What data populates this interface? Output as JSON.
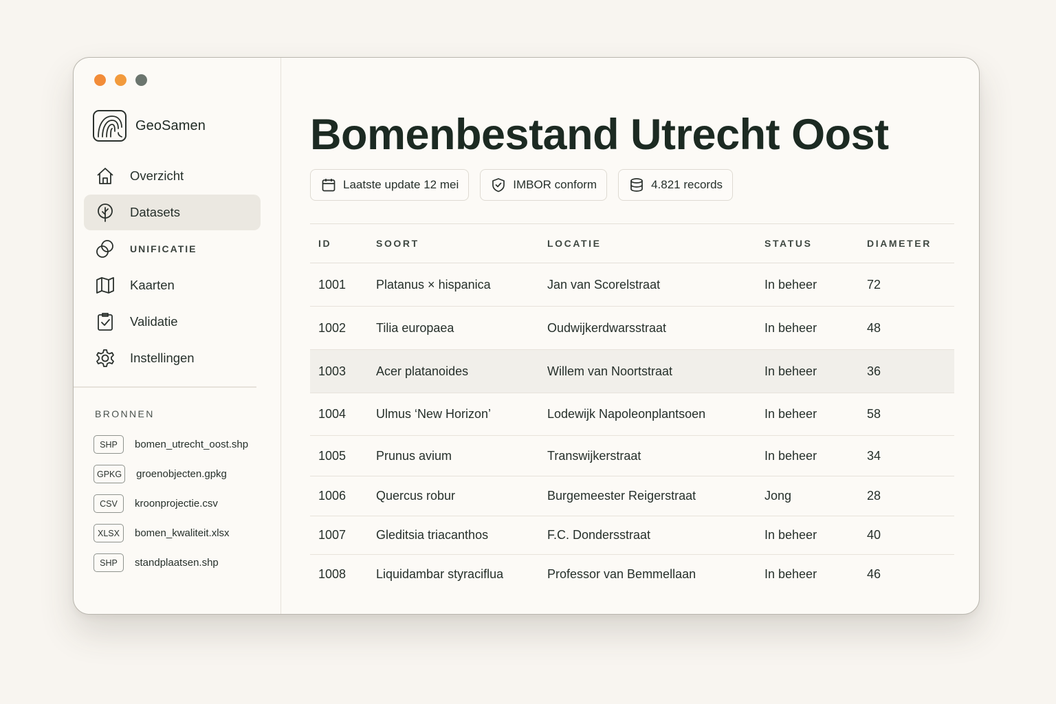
{
  "window": {
    "traffic_lights": [
      {
        "name": "close",
        "color": "#f28c38"
      },
      {
        "name": "minimize",
        "color": "#f29a3c"
      },
      {
        "name": "zoom",
        "color": "#6b756e"
      }
    ]
  },
  "sidebar": {
    "brand": "GeoSamen",
    "nav": [
      {
        "label": "Overzicht",
        "icon": "home-icon",
        "active": false
      },
      {
        "label": "Datasets",
        "icon": "tree-icon",
        "active": true
      },
      {
        "label": "UNIFICATIE",
        "icon": "overlap-circles-icon",
        "active": false
      },
      {
        "label": "Kaarten",
        "icon": "map-icon",
        "active": false
      },
      {
        "label": "Validatie",
        "icon": "clipboard-check-icon",
        "active": false
      },
      {
        "label": "Instellingen",
        "icon": "gear-icon",
        "active": false
      }
    ],
    "sources_title": "BRONNEN",
    "sources": [
      {
        "type": "SHP",
        "name": "bomen_utrecht_oost.shp"
      },
      {
        "type": "GPKG",
        "name": "groenobjecten.gpkg"
      },
      {
        "type": "CSV",
        "name": "kroonprojectie.csv"
      },
      {
        "type": "XLSX",
        "name": "bomen_kwaliteit.xlsx"
      },
      {
        "type": "SHP",
        "name": "standplaatsen.shp"
      }
    ]
  },
  "main": {
    "title": "Bomenbestand Utrecht Oost",
    "pills": [
      {
        "icon": "calendar-icon",
        "text": "Laatste update 12 mei"
      },
      {
        "icon": "shield-check-icon",
        "text": "IMBOR conform"
      },
      {
        "icon": "database-icon",
        "text": "4.821 records"
      }
    ],
    "table": {
      "headers": [
        "ID",
        "SOORT",
        "LOCATIE",
        "STATUS",
        "DIAMETER"
      ],
      "rows": [
        [
          "1001",
          "Platanus × hispanica",
          "Jan van Scorelstraat",
          "In beheer",
          "72"
        ],
        [
          "1002",
          "Tilia europaea",
          "Oudwijkerdwarsstraat",
          "In beheer",
          "48"
        ],
        [
          "1003",
          "Acer platanoides",
          "Willem van Noortstraat",
          "In beheer",
          "36"
        ],
        [
          "1004",
          "Ulmus ‘New Horizon’",
          "Lodewijk Napoleonplantsoen",
          "In beheer",
          "58"
        ],
        [
          "1005",
          "Prunus avium",
          "Transwijkerstraat",
          "In beheer",
          "34"
        ],
        [
          "1006",
          "Quercus robur",
          "Burgemeester Reigerstraat",
          "Jong",
          "28"
        ],
        [
          "1007",
          "Gleditsia triacanthos",
          "F.C. Dondersstraat",
          "In beheer",
          "40"
        ],
        [
          "1008",
          "Liquidambar styraciflua",
          "Professor van Bemmellaan",
          "In beheer",
          "46"
        ]
      ],
      "highlighted_row_index": 2
    }
  }
}
